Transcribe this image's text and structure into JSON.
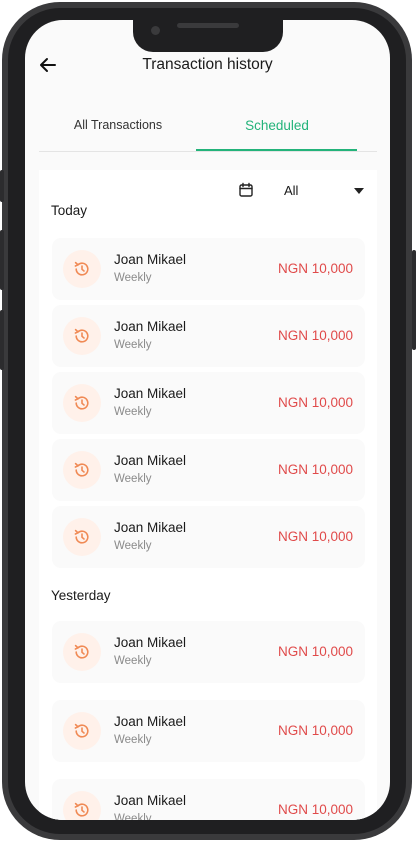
{
  "header": {
    "title": "Transaction history"
  },
  "tabs": [
    {
      "label": "All Transactions",
      "active": false
    },
    {
      "label": "Scheduled",
      "active": true
    }
  ],
  "filter": {
    "selected": "All"
  },
  "sections": [
    {
      "label": "Today",
      "items": [
        {
          "name": "Joan Mikael",
          "frequency": "Weekly",
          "amount": "NGN 10,000"
        },
        {
          "name": "Joan Mikael",
          "frequency": "Weekly",
          "amount": "NGN 10,000"
        },
        {
          "name": "Joan Mikael",
          "frequency": "Weekly",
          "amount": "NGN 10,000"
        },
        {
          "name": "Joan Mikael",
          "frequency": "Weekly",
          "amount": "NGN 10,000"
        },
        {
          "name": "Joan Mikael",
          "frequency": "Weekly",
          "amount": "NGN 10,000"
        }
      ]
    },
    {
      "label": "Yesterday",
      "items": [
        {
          "name": "Joan Mikael",
          "frequency": "Weekly",
          "amount": "NGN 10,000"
        },
        {
          "name": "Joan Mikael",
          "frequency": "Weekly",
          "amount": "NGN 10,000"
        },
        {
          "name": "Joan Mikael",
          "frequency": "Weekly",
          "amount": "NGN 10,000"
        }
      ]
    }
  ],
  "icons": {
    "back": "arrow-left-icon",
    "calendar": "calendar-icon",
    "dropdown": "caret-down-icon",
    "schedule": "history-clock-icon"
  },
  "colors": {
    "accent": "#23b37a",
    "amount": "#e04a4a",
    "icon": "#f08a55",
    "icon_bg": "#fff1ea"
  }
}
